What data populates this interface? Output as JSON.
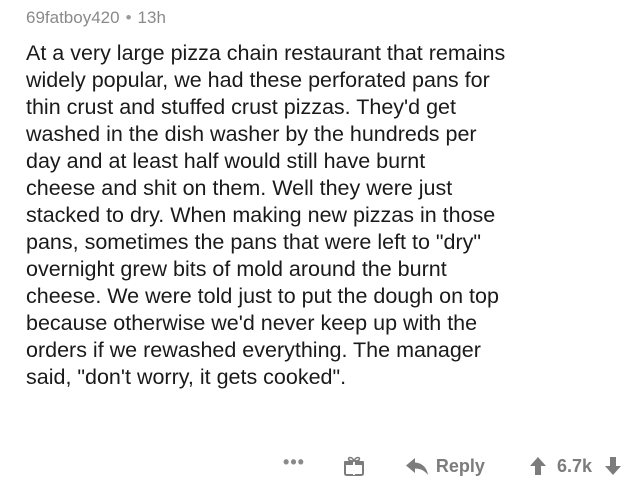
{
  "comment": {
    "username": "69fatboy420",
    "separator": "•",
    "age": "13h",
    "body": "At a very large pizza chain restaurant that remains\nwidely popular, we had these perforated pans for\nthin crust and stuffed crust pizzas. They'd get\nwashed in the dish washer by the hundreds per\nday and at least half would still have  burnt\ncheese and shit on them. Well they were just\nstacked to dry. When making new pizzas in those\npans, sometimes the pans that were left to \"dry\"\novernight grew bits of mold around the burnt\ncheese. We were told just to put the dough on top\nbecause otherwise we'd never keep up with the\norders if we rewashed everything. The manager\nsaid, \"don't worry, it gets cooked\"."
  },
  "actions": {
    "more_label": "•••",
    "reply_label": "Reply",
    "score": "6.7k",
    "icons": {
      "more": "more-options-icon",
      "gift": "gift-icon",
      "reply": "reply-arrow-icon",
      "upvote": "upvote-arrow-icon",
      "downvote": "downvote-arrow-icon"
    }
  },
  "colors": {
    "text": "#1a1a1b",
    "meta": "#8a8a8a",
    "action": "#7c7c7c"
  }
}
